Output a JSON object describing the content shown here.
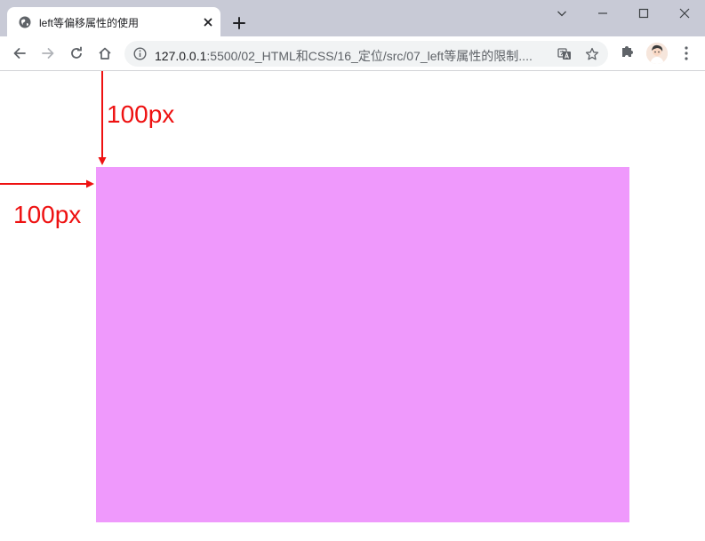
{
  "tab": {
    "title": "left等偏移属性的使用",
    "favicon": "globe-icon",
    "close": "close-icon"
  },
  "window_controls": [
    "chevron-down-icon",
    "minimize-icon",
    "maximize-icon",
    "close-icon"
  ],
  "toolbar": {
    "back": "back-arrow-icon",
    "forward": "forward-arrow-icon",
    "reload": "reload-icon",
    "home": "home-icon",
    "url_host": "127.0.0.1",
    "url_rest": ":5500/02_HTML和CSS/16_定位/src/07_left等属性的限制....",
    "translate": "translate-icon",
    "bookmark": "star-icon",
    "extensions": "puzzle-icon",
    "menu": "kebab-menu-icon"
  },
  "page": {
    "box_color": "#ef99fc",
    "annotation_color": "#ee1111",
    "top_offset_label": "100px",
    "left_offset_label": "100px"
  }
}
